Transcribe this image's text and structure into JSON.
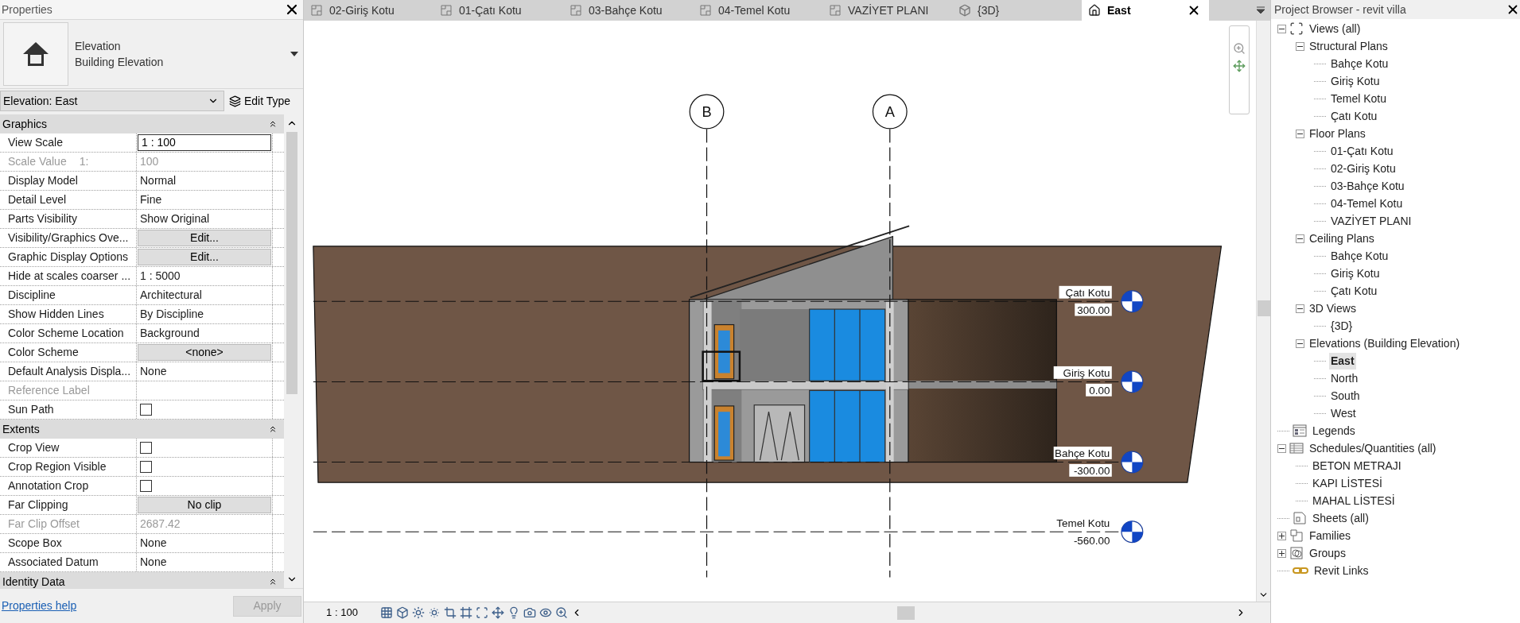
{
  "properties": {
    "title": "Properties",
    "type_selector": {
      "category": "Elevation",
      "type": "Building Elevation"
    },
    "instance": "Elevation: East",
    "edit_type": "Edit Type",
    "sections": [
      {
        "title": "Graphics",
        "expanded": true,
        "rows": [
          {
            "label": "View Scale",
            "value": "1 : 100",
            "kind": "field",
            "disabled": false
          },
          {
            "label": "Scale Value",
            "suffix": "1:",
            "value": "100",
            "kind": "text",
            "disabled": true
          },
          {
            "label": "Display Model",
            "value": "Normal",
            "kind": "text",
            "disabled": false
          },
          {
            "label": "Detail Level",
            "value": "Fine",
            "kind": "text",
            "disabled": false
          },
          {
            "label": "Parts Visibility",
            "value": "Show Original",
            "kind": "text",
            "disabled": false
          },
          {
            "label": "Visibility/Graphics Ove...",
            "value": "Edit...",
            "kind": "button",
            "disabled": false
          },
          {
            "label": "Graphic Display Options",
            "value": "Edit...",
            "kind": "button",
            "disabled": false
          },
          {
            "label": "Hide at scales coarser ...",
            "value": " 1 : 5000",
            "kind": "text",
            "disabled": false
          },
          {
            "label": "Discipline",
            "value": "Architectural",
            "kind": "text",
            "disabled": false
          },
          {
            "label": "Show Hidden Lines",
            "value": "By Discipline",
            "kind": "text",
            "disabled": false
          },
          {
            "label": "Color Scheme Location",
            "value": "Background",
            "kind": "text",
            "disabled": false
          },
          {
            "label": "Color Scheme",
            "value": "<none>",
            "kind": "button",
            "disabled": false
          },
          {
            "label": "Default Analysis Displa...",
            "value": "None",
            "kind": "text",
            "disabled": false
          },
          {
            "label": "Reference Label",
            "kind": "text",
            "disabled": true
          },
          {
            "label": "Sun Path",
            "kind": "checkbox",
            "checked": false,
            "disabled": false
          }
        ]
      },
      {
        "title": "Extents",
        "expanded": true,
        "rows": [
          {
            "label": "Crop View",
            "kind": "checkbox",
            "checked": false,
            "disabled": false
          },
          {
            "label": "Crop Region Visible",
            "kind": "checkbox",
            "checked": false,
            "disabled": false
          },
          {
            "label": "Annotation Crop",
            "kind": "checkbox",
            "checked": false,
            "disabled": false
          },
          {
            "label": "Far Clipping",
            "value": "No clip",
            "kind": "button",
            "disabled": false
          },
          {
            "label": "Far Clip Offset",
            "value": "2687.42",
            "kind": "text",
            "disabled": true
          },
          {
            "label": "Scope Box",
            "value": "None",
            "kind": "text",
            "disabled": false
          },
          {
            "label": "Associated Datum",
            "value": "None",
            "kind": "text",
            "disabled": false
          }
        ]
      },
      {
        "title": "Identity Data",
        "expanded": true
      }
    ],
    "help_link": "Properties help",
    "apply": {
      "label": "Apply",
      "disabled": true
    }
  },
  "tabs": [
    {
      "label": "02-Giriş Kotu",
      "kind": "plan",
      "selected": false
    },
    {
      "label": "01-Çatı Kotu",
      "kind": "plan",
      "selected": false
    },
    {
      "label": "03-Bahçe Kotu",
      "kind": "plan",
      "selected": false
    },
    {
      "label": "04-Temel Kotu",
      "kind": "plan",
      "selected": false
    },
    {
      "label": "VAZİYET PLANI",
      "kind": "plan",
      "selected": false
    },
    {
      "label": "{3D}",
      "kind": "model",
      "selected": false
    },
    {
      "label": "East",
      "kind": "elevation",
      "selected": true
    }
  ],
  "view": {
    "grids": [
      {
        "label": "B"
      },
      {
        "label": "A"
      }
    ],
    "levels": [
      {
        "name": "Çatı Kotu",
        "elevation": "300.00"
      },
      {
        "name": "Giriş Kotu",
        "elevation": "0.00"
      },
      {
        "name": "Bahçe Kotu",
        "elevation": "-300.00"
      },
      {
        "name": "Temel Kotu",
        "elevation": "-560.00"
      }
    ]
  },
  "status_bar": {
    "scale": "1 : 100"
  },
  "project_browser": {
    "title": "Project Browser - revit villa",
    "tree": [
      {
        "label": "Views (all)",
        "kind": "views",
        "expanded": true,
        "selected": false,
        "children": [
          {
            "label": "Structural Plans",
            "expanded": true,
            "selected": false,
            "children": [
              {
                "label": "Bahçe Kotu",
                "selected": false
              },
              {
                "label": "Giriş Kotu",
                "selected": false
              },
              {
                "label": "Temel Kotu",
                "selected": false
              },
              {
                "label": "Çatı Kotu",
                "selected": false
              }
            ]
          },
          {
            "label": "Floor Plans",
            "expanded": true,
            "selected": false,
            "children": [
              {
                "label": "01-Çatı Kotu",
                "selected": false
              },
              {
                "label": "02-Giriş Kotu",
                "selected": false
              },
              {
                "label": "03-Bahçe Kotu",
                "selected": false
              },
              {
                "label": "04-Temel Kotu",
                "selected": false
              },
              {
                "label": "VAZİYET PLANI",
                "selected": false
              }
            ]
          },
          {
            "label": "Ceiling Plans",
            "expanded": true,
            "selected": false,
            "children": [
              {
                "label": "Bahçe Kotu",
                "selected": false
              },
              {
                "label": "Giriş Kotu",
                "selected": false
              },
              {
                "label": "Çatı Kotu",
                "selected": false
              }
            ]
          },
          {
            "label": "3D Views",
            "expanded": true,
            "selected": false,
            "children": [
              {
                "label": "{3D}",
                "selected": false
              }
            ]
          },
          {
            "label": "Elevations (Building Elevation)",
            "expanded": true,
            "selected": false,
            "children": [
              {
                "label": "East",
                "selected": true
              },
              {
                "label": "North",
                "selected": false
              },
              {
                "label": "South",
                "selected": false
              },
              {
                "label": "West",
                "selected": false
              }
            ]
          }
        ]
      },
      {
        "label": "Legends",
        "kind": "legends",
        "selected": false
      },
      {
        "label": "Schedules/Quantities (all)",
        "kind": "schedules",
        "expanded": true,
        "selected": false,
        "children": [
          {
            "label": "BETON METRAJI",
            "selected": false
          },
          {
            "label": "KAPI LİSTESİ",
            "selected": false
          },
          {
            "label": "MAHAL LİSTESİ",
            "selected": false
          }
        ]
      },
      {
        "label": "Sheets (all)",
        "kind": "sheets",
        "selected": false
      },
      {
        "label": "Families",
        "kind": "families",
        "expanded": false,
        "selected": false
      },
      {
        "label": "Groups",
        "kind": "groups",
        "expanded": false,
        "selected": false
      },
      {
        "label": "Revit Links",
        "kind": "links",
        "selected": false
      }
    ]
  }
}
